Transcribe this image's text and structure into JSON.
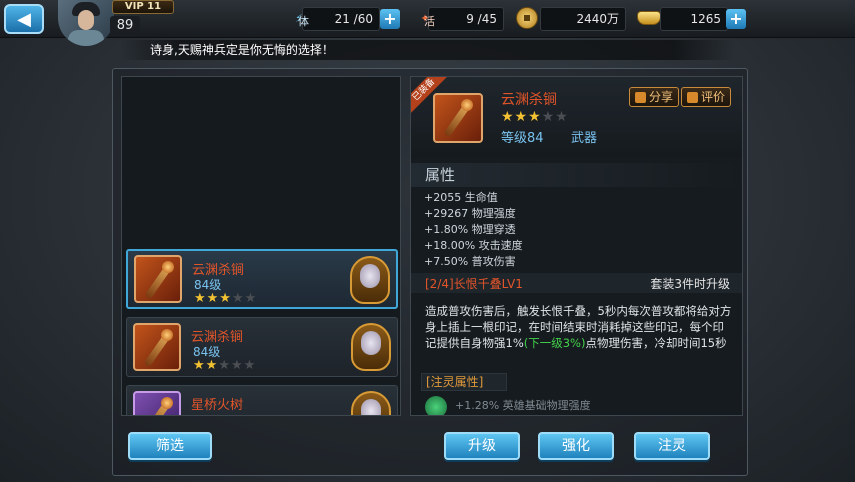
{
  "header": {
    "vip": "VIP 11",
    "player_level": "89",
    "stamina": {
      "label": "体",
      "value": "21 /60"
    },
    "vitality": {
      "label": "活",
      "value": "9 /45"
    },
    "coins": {
      "value": "2440万"
    },
    "gold": {
      "value": "1265"
    }
  },
  "marquee": "诗身,天赐神兵定是你无悔的选择！",
  "item_list": [
    {
      "name": "云渊杀锏",
      "level": "84级",
      "stars": 3,
      "max_stars": 5,
      "selected": true
    },
    {
      "name": "云渊杀锏",
      "level": "84级",
      "stars": 2,
      "max_stars": 5,
      "selected": false
    },
    {
      "name": "星桥火树",
      "level": "",
      "stars": 0,
      "max_stars": 5,
      "selected": false
    }
  ],
  "filter_button": "筛选",
  "detail": {
    "corner_tag": "已装备",
    "name": "云渊杀锏",
    "stars": 3,
    "max_stars": 5,
    "level": "等级84",
    "type": "武器",
    "share_button": "分享",
    "review_button": "评价",
    "attributes_title": "属性",
    "attributes": [
      "+2055 生命值",
      "+29267 物理强度",
      "+1.80% 物理穿透",
      "+18.00% 攻击速度",
      "+7.50% 普攻伤害"
    ],
    "set_title": "[2/4]长恨千叠LV1",
    "set_note": "套装3件时升级",
    "description_1": "造成普攻伤害后，触发长恨千叠，5秒内每次普攻都将给对方身上插上一根印记，在时间结束时消耗掉这些印记，每个印记提供自身物强1%",
    "description_green": "(下一级3%)",
    "description_2": "点物理伤害，冷却时间15秒",
    "spirit_title": "[注灵属性]",
    "spirit_attr": "+1.28% 英雄基础物理强度"
  },
  "buttons": {
    "upgrade": "升级",
    "enhance": "强化",
    "spirit": "注灵"
  },
  "colors": {
    "accent_blue": "#3fa8d8",
    "item_name": "#e2552a",
    "level_text": "#79c2ee",
    "star": "#f2c233",
    "highlight_green": "#43d24b"
  }
}
